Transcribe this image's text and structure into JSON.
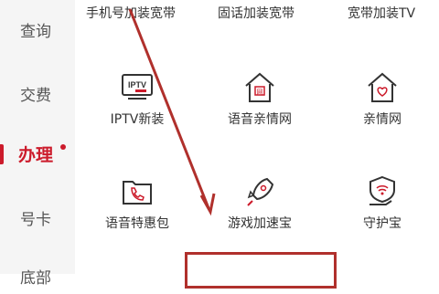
{
  "sidebar": {
    "items": [
      {
        "label": "查询"
      },
      {
        "label": "交费"
      },
      {
        "label": "办理",
        "active": true
      },
      {
        "label": "号卡"
      },
      {
        "label": "底部"
      }
    ]
  },
  "top_row": {
    "items": [
      {
        "label": "手机号加装宽带"
      },
      {
        "label": "固话加装宽带"
      },
      {
        "label": "宽带加装TV"
      }
    ]
  },
  "grid": {
    "row1": [
      {
        "label": "IPTV新装",
        "icon": "iptv-icon",
        "icon_text": "IPTV"
      },
      {
        "label": "语音亲情网",
        "icon": "house-icon",
        "icon_text": "网"
      },
      {
        "label": "亲情网",
        "icon": "house-heart-icon"
      }
    ],
    "row2": [
      {
        "label": "语音特惠包",
        "icon": "folder-phone-icon"
      },
      {
        "label": "游戏加速宝",
        "icon": "rocket-icon"
      },
      {
        "label": "守护宝",
        "icon": "shield-hand-icon"
      }
    ]
  },
  "colors": {
    "accent": "#cc1b2b",
    "annotation": "#b0302c",
    "sidebar_bg": "#f5f5f5"
  }
}
